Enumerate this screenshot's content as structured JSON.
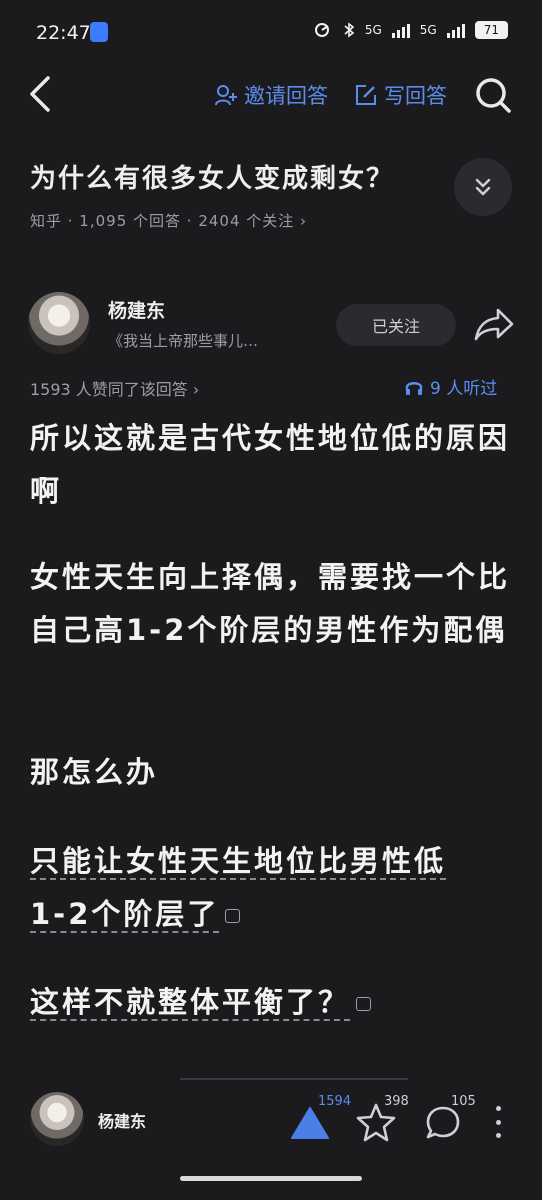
{
  "status_bar": {
    "time": "22:47",
    "signal1": "5G",
    "signal2": "5G",
    "battery": "71"
  },
  "nav": {
    "invite_label": "邀请回答",
    "write_label": "写回答"
  },
  "question": {
    "title": "为什么有很多女人变成剩女？",
    "meta": "知乎 · 1,095 个回答 · 2404 个关注 ›"
  },
  "author": {
    "name": "杨建东",
    "bio": "《我当上帝那些事儿…",
    "follow_label": "已关注"
  },
  "answer": {
    "upvote_text": "1593 人赞同了该回答 ›",
    "listen_text": "9 人听过",
    "paragraphs": {
      "p1": "所以这就是古代女性地位低的原因啊",
      "p2": "女性天生向上择偶，需要找一个比自己高1-2个阶层的男性作为配偶",
      "p3": "那怎么办",
      "p4a": "只能让女性天生地位比男性低",
      "p4b": "1-2个阶层了",
      "p5": "这样不就整体平衡了？"
    }
  },
  "bottom_bar": {
    "author": "杨建东",
    "votes": "1594",
    "stars": "398",
    "comments": "105"
  },
  "colors": {
    "accent": "#5b8def",
    "background": "#1b1b1e"
  },
  "icons": [
    "back-icon",
    "invite-icon",
    "write-icon",
    "search-icon",
    "chevron-down-icon",
    "share-icon",
    "headphones-icon",
    "comment-icon",
    "upvote-icon",
    "star-icon",
    "comment-bubble-icon",
    "more-icon"
  ]
}
